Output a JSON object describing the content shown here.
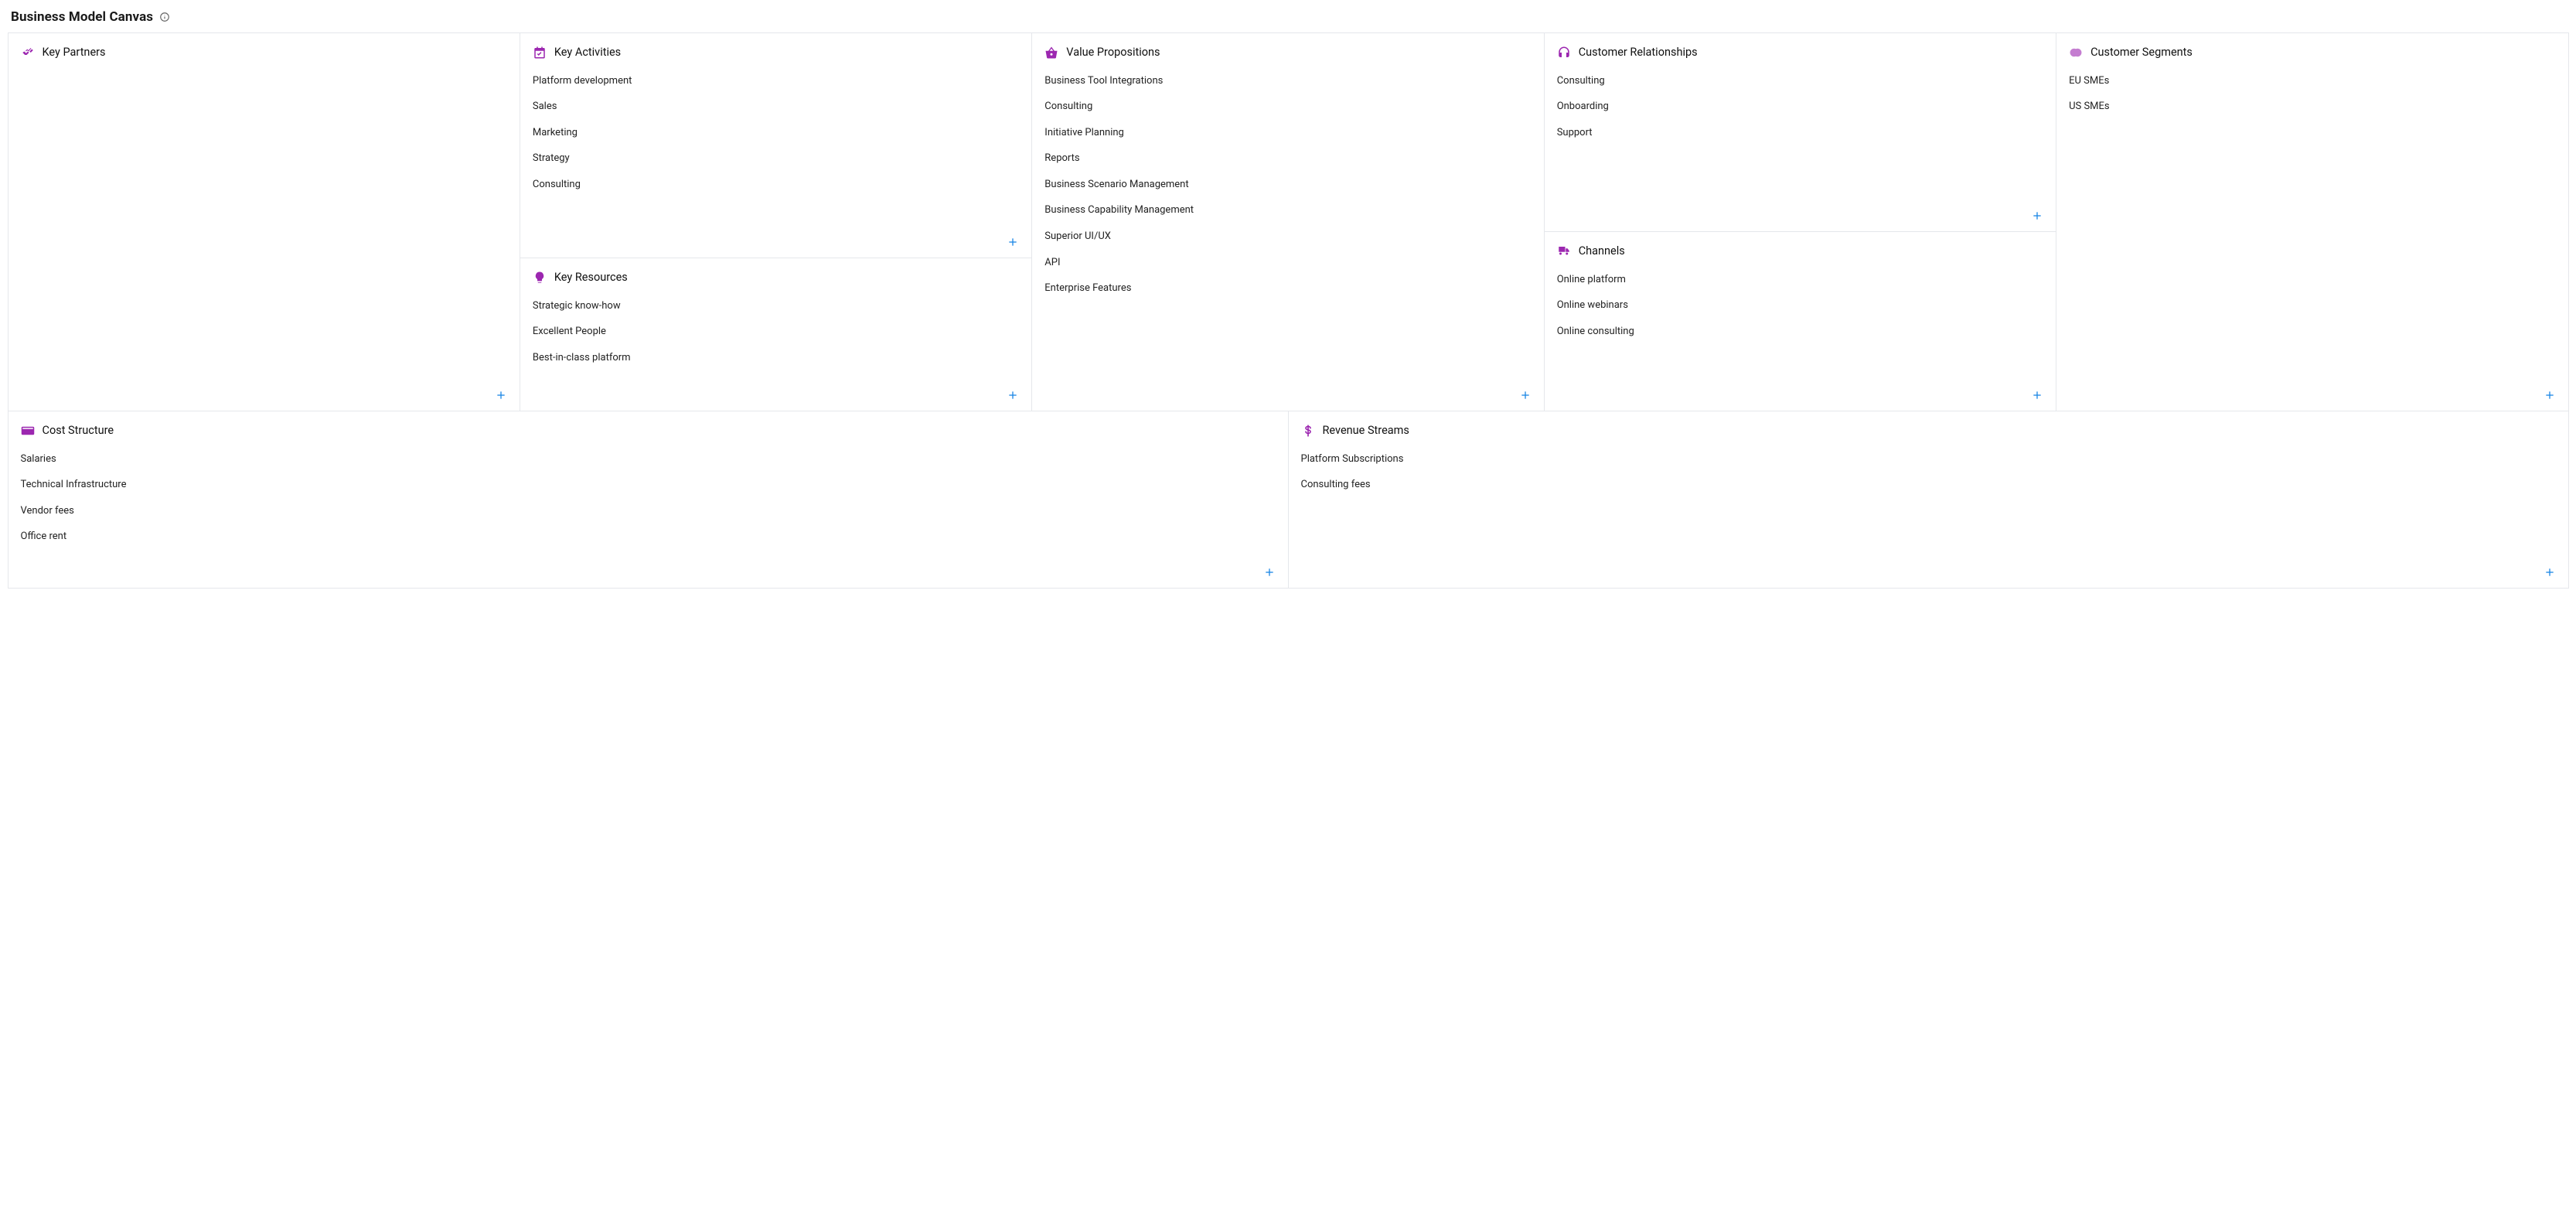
{
  "page_title": "Business Model Canvas",
  "sections": {
    "key_partners": {
      "title": "Key Partners",
      "items": []
    },
    "key_activities": {
      "title": "Key Activities",
      "items": [
        "Platform development",
        "Sales",
        "Marketing",
        "Strategy",
        "Consulting"
      ]
    },
    "key_resources": {
      "title": "Key Resources",
      "items": [
        "Strategic know-how",
        "Excellent People",
        "Best-in-class platform"
      ]
    },
    "value_propositions": {
      "title": "Value Propositions",
      "items": [
        "Business Tool Integrations",
        "Consulting",
        "Initiative Planning",
        "Reports",
        "Business Scenario Management",
        "Business Capability Management",
        "Superior UI/UX",
        "API",
        "Enterprise Features"
      ]
    },
    "customer_relationships": {
      "title": "Customer Relationships",
      "items": [
        "Consulting",
        "Onboarding",
        "Support"
      ]
    },
    "channels": {
      "title": "Channels",
      "items": [
        "Online platform",
        "Online webinars",
        "Online consulting"
      ]
    },
    "customer_segments": {
      "title": "Customer Segments",
      "items": [
        "EU SMEs",
        "US SMEs"
      ]
    },
    "cost_structure": {
      "title": "Cost Structure",
      "items": [
        "Salaries",
        "Technical Infrastructure",
        "Vendor fees",
        "Office rent"
      ]
    },
    "revenue_streams": {
      "title": "Revenue Streams",
      "items": [
        "Platform Subscriptions",
        "Consulting fees"
      ]
    }
  },
  "colors": {
    "icon_accent": "#9c27b0",
    "add_button": "#1e88e5",
    "border": "#e5e7eb"
  }
}
